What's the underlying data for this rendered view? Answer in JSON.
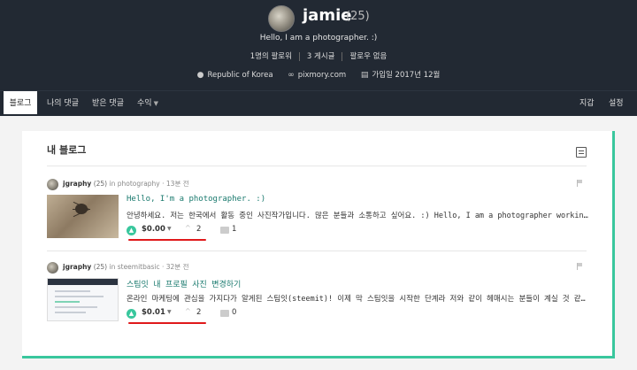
{
  "profile": {
    "name": "jamie",
    "reputation": "(25)",
    "about": "Hello, I am a photographer. :)",
    "followers": "1명의 팔로워",
    "posts": "3 게시글",
    "following": "팔로우 없음",
    "location": "Republic of Korea",
    "website": "pixmory.com",
    "joined": "가입일 2017년 12월",
    "icons": {
      "location": "map-pin-icon",
      "website": "link-icon",
      "joined": "calendar-icon"
    }
  },
  "nav": {
    "tabs": [
      "블로그",
      "나의 댓글",
      "받은 댓글",
      "수익"
    ],
    "right": [
      "지갑",
      "설정"
    ]
  },
  "blog": {
    "title": "내 블로그",
    "posts": [
      {
        "author": "jgraphy",
        "rep": "(25)",
        "in_label": "in",
        "category": "photography",
        "time": "· 13분 전",
        "title": "Hello, I'm a photographer. :)",
        "body": "안녕하세요. 저는 한국에서 활동 중인 사진작가입니다. 많은 분들과 소통하고 싶어요. :) Hello, I am a photographer working in Korea. I want to talk with many people.",
        "payout": "$0.00",
        "votes": "2",
        "comments": "1"
      },
      {
        "author": "jgraphy",
        "rep": "(25)",
        "in_label": "in",
        "category": "steemitbasic",
        "time": "· 32분 전",
        "title": "스팀잇 내 프로필 사진 변경하기",
        "body": "온라인 마케팅에 관심을 가지다가 알게된 스팀잇(steemit)! 이제 막 스팀잇을 시작한 단계라 저와 같이 헤매시는 분들이 계실 것 같아서 정리해 봅니다.",
        "payout": "$0.01",
        "votes": "2",
        "comments": "0"
      }
    ]
  },
  "colors": {
    "header_bg": "#222933",
    "accent": "#39c79d",
    "highlight": "#e0191b"
  }
}
